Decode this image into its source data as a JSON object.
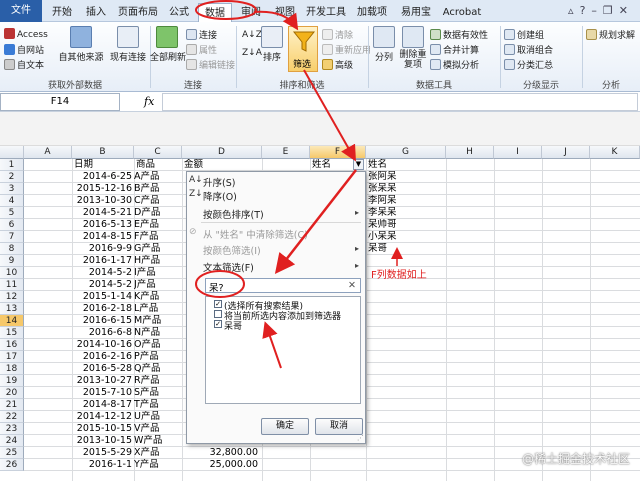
{
  "tabs": [
    "文件",
    "开始",
    "插入",
    "页面布局",
    "公式",
    "数据",
    "审阅",
    "视图",
    "开发工具",
    "加载项",
    "易用宝",
    "Acrobat"
  ],
  "ribbon": {
    "get_external": {
      "items": [
        "Access",
        "自网站",
        "自文本",
        "自其他来源",
        "现有连接"
      ],
      "label": "获取外部数据"
    },
    "connections": {
      "refresh": "全部刷新",
      "items": [
        "连接",
        "属性",
        "编辑链接"
      ],
      "label": "连接"
    },
    "sort_filter": {
      "sort": "排序",
      "filter": "筛选",
      "items": [
        "清除",
        "重新应用",
        "高级"
      ],
      "label": "排序和筛选"
    },
    "data_tools": {
      "split": "分列",
      "dedupe": "删除重复项",
      "items": [
        "数据有效性",
        "合并计算",
        "模拟分析"
      ],
      "label": "数据工具"
    },
    "outline": {
      "items": [
        "创建组",
        "取消组合",
        "分类汇总"
      ],
      "label": "分级显示"
    },
    "analysis": {
      "items": [
        "规划求解"
      ],
      "label": "分析"
    }
  },
  "formula_bar": {
    "name_box": "F14",
    "fx": "fx",
    "content": ""
  },
  "columns": [
    "A",
    "B",
    "C",
    "D",
    "E",
    "F",
    "G",
    "H",
    "I",
    "J",
    "K"
  ],
  "rows": [
    "1",
    "2",
    "3",
    "4",
    "5",
    "6",
    "7",
    "8",
    "9",
    "10",
    "11",
    "12",
    "13",
    "14",
    "15",
    "16",
    "17",
    "18",
    "19",
    "20",
    "21",
    "22",
    "23",
    "24",
    "25",
    "26"
  ],
  "selected_row": "14",
  "headers": {
    "date": "日期",
    "product": "商品",
    "amount": "金额",
    "name_f": "姓名",
    "name_g": "姓名"
  },
  "dates": [
    "2014-6-25",
    "2015-12-16",
    "2013-10-30",
    "2014-5-21",
    "2016-5-13",
    "2014-8-15",
    "2016-9-9",
    "2016-1-17",
    "2014-5-2",
    "2014-5-2",
    "2015-1-14",
    "2016-2-18",
    "2016-6-15",
    "2016-6-8",
    "2014-10-16",
    "2016-2-16",
    "2016-5-28",
    "2013-10-27",
    "2015-7-10",
    "2014-8-17",
    "2014-12-12",
    "2015-10-15",
    "2013-10-15",
    "2015-5-29",
    "2016-1-1"
  ],
  "products": [
    "A产品",
    "B产品",
    "C产品",
    "D产品",
    "E产品",
    "F产品",
    "G产品",
    "H产品",
    "I产品",
    "J产品",
    "K产品",
    "L产品",
    "M产品",
    "N产品",
    "O产品",
    "P产品",
    "Q产品",
    "R产品",
    "S产品",
    "T产品",
    "U产品",
    "V产品",
    "W产品",
    "X产品",
    "Y产品"
  ],
  "amounts": [
    "32,800.00",
    "25,000.00"
  ],
  "g_names": [
    "张阿呆",
    "张呆呆",
    "李阿呆",
    "李呆呆",
    "呆帅哥",
    "小呆呆",
    "呆哥"
  ],
  "filter_menu": {
    "sort_asc": "升序(S)",
    "sort_desc": "降序(O)",
    "sort_color": "按颜色排序(T)",
    "clear": "从 \"姓名\" 中清除筛选(C)",
    "filter_color": "按颜色筛选(I)",
    "text_filter": "文本筛选(F)",
    "search": "呆?",
    "items": [
      "(选择所有搜索结果)",
      "将当前所选内容添加到筛选器",
      "呆哥"
    ],
    "ok": "确定",
    "cancel": "取消"
  },
  "annotation": "F列数据如上",
  "watermark": "@稀土掘金技术社区"
}
